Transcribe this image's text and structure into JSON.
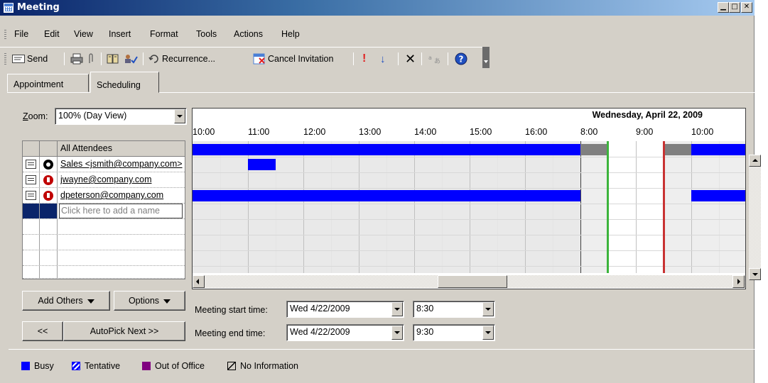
{
  "window": {
    "title": "Meeting"
  },
  "menu": [
    "File",
    "Edit",
    "View",
    "Insert",
    "Format",
    "Tools",
    "Actions",
    "Help"
  ],
  "toolbar": {
    "send": "Send",
    "recurrence": "Recurrence...",
    "cancel_invitation": "Cancel Invitation"
  },
  "tabs": [
    {
      "label": "Appointment",
      "active": false
    },
    {
      "label": "Scheduling",
      "active": true
    }
  ],
  "zoom": {
    "label": "Zoom:",
    "value": "100% (Day View)"
  },
  "attendees": {
    "header": "All Attendees",
    "rows": [
      {
        "name": "Sales <jsmith@company.com>",
        "role": "organizer"
      },
      {
        "name": "jwayne@company.com",
        "role": "required"
      },
      {
        "name": "dpeterson@company.com",
        "role": "required"
      }
    ],
    "add_placeholder": "Click here to add a name"
  },
  "grid": {
    "date": "Wednesday, April 22, 2009",
    "times": [
      "10:00",
      "11:00",
      "12:00",
      "13:00",
      "14:00",
      "15:00",
      "16:00",
      "8:00",
      "9:00",
      "10:00"
    ]
  },
  "buttons": {
    "add_others": "Add Others",
    "options": "Options",
    "prev": "<<",
    "autopick_next": "AutoPick Next >>"
  },
  "meeting": {
    "start_label": "Meeting start time:",
    "start_date": "Wed 4/22/2009",
    "start_time": "8:30",
    "end_label": "Meeting end time:",
    "end_date": "Wed 4/22/2009",
    "end_time": "9:30"
  },
  "legend": {
    "busy": "Busy",
    "tentative": "Tentative",
    "out_of_office": "Out of Office",
    "no_information": "No Information",
    "colors": {
      "busy": "#0000ff",
      "tentative": "#0000ff",
      "out_of_office": "#800080"
    }
  }
}
